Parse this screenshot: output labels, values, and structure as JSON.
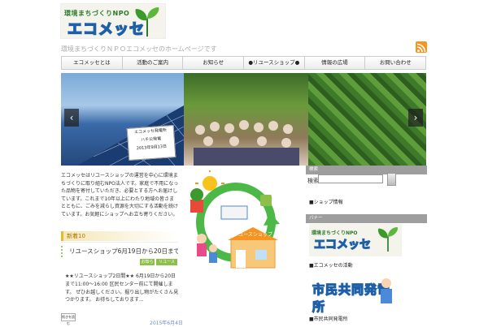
{
  "header": {
    "logo_kicker": "環境まちづくりNPO",
    "logo_brand": "エコメッセ",
    "tagline": "環境まちづくりＮＰＯエコメッセのホームページです"
  },
  "nav": {
    "items": [
      "エコメッセとは",
      "活動のご案内",
      "お知らせ",
      "●リユースショップ●",
      "情報の広場",
      "お問い合わせ"
    ]
  },
  "slider": {
    "sign_lines": [
      "エコメッセ発電所",
      "ハチ公発電",
      "2013年9月13日"
    ],
    "prev": "‹",
    "next": "›"
  },
  "intro_text": "エコメッセはリユースショップの運営を中心に環境まちづくりに取り組むNPO法人です。家庭で不用になった品物を寄付していただき、必要とする方へお届けしています。これまで10年以上にわたり地域の皆さまとともに、ごみを減らし資源を大切にする活動を続けています。お気軽にショップへお立ち寄りください。",
  "illustration": {
    "shop_label": "リユースショップ"
  },
  "sidebar": {
    "search_head": "検索",
    "search_label": "検索:",
    "search_value": "",
    "link1": "■ショップ情報",
    "banner_head": "バナー",
    "link2": "■エコメッセの活動",
    "logo_kicker": "環境まちづくりNPO",
    "logo_brand": "エコメッセ",
    "hatsuden": "市民共同発電所",
    "link3": "■市民共同発電所"
  },
  "news": {
    "head": "新着10",
    "post_title": "リユースショップ6月19日から20日まで",
    "tags": [
      "お知らせ",
      "リユース"
    ],
    "body": "★★リユースショップ2日間★★ 6月19日から20日まで11:00〜16:00 区民センター前にて開催します。 ぜひお越しください。掘り出し物がたくさん見つかります。 お待ちしております...",
    "more": "続きを読む",
    "date": "2015年6月4日"
  },
  "colors": {
    "brand_green": "#8cc04a",
    "brand_blue": "#1e5fa8",
    "rss_orange": "#f7931e"
  }
}
